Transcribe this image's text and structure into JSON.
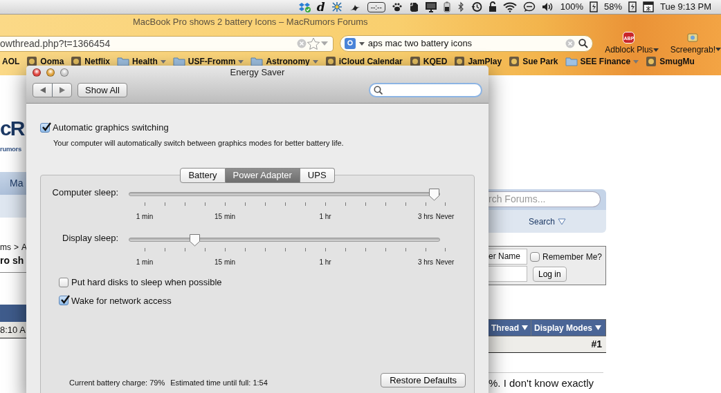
{
  "menu_bar": {
    "letter_icon": "d",
    "timer_display": "--:--",
    "battery_readings": [
      "100%",
      "58%"
    ],
    "clock": "Tue 9:13 PM"
  },
  "browser": {
    "title": "MacBook Pro shows 2 battery Icons – MacRumors Forums",
    "url": "owthread.php?t=1366454",
    "search_query": "aps mac two battery icons",
    "extensions": [
      {
        "label": "Adblock Plus",
        "kind": "abp",
        "badge": "ABP"
      },
      {
        "label": "Screengrab!",
        "kind": "screengrab"
      }
    ],
    "bookmarks": [
      {
        "label": "AOL",
        "kind": "plain"
      },
      {
        "label": "Ooma",
        "kind": "site"
      },
      {
        "label": "Netflix",
        "kind": "site"
      },
      {
        "label": "Health",
        "kind": "folder"
      },
      {
        "label": "USF-Fromm",
        "kind": "folder"
      },
      {
        "label": "Astronomy",
        "kind": "folder"
      },
      {
        "label": "iCloud Calendar",
        "kind": "site"
      },
      {
        "label": "KQED",
        "kind": "site"
      },
      {
        "label": "JamPlay",
        "kind": "site"
      },
      {
        "label": "Sue Park",
        "kind": "site"
      },
      {
        "label": "SEE Finance",
        "kind": "folder"
      },
      {
        "label": "SmugMu",
        "kind": "site"
      }
    ]
  },
  "web_page": {
    "logo": "cR",
    "logo_tagline": "rumors",
    "nav_tab": "Ma",
    "breadcrumb": {
      "links": [
        "ms",
        "A"
      ],
      "separator": ">"
    },
    "thread_title": "ro sh",
    "post_date": "8:10 A",
    "search_placeholder": "rch Forums...",
    "search_link": "Search",
    "username_value": "er Name",
    "remember_me": {
      "label": "Remember Me?",
      "checked": false
    },
    "login_button": "Log in",
    "toolbar": [
      "Thread",
      "Display Modes"
    ],
    "post_number": "#1",
    "post_text": "%. I don't know exactly"
  },
  "dialog": {
    "title": "Energy Saver",
    "show_all": "Show All",
    "graphics_switching": {
      "label": "Automatic graphics switching",
      "checked": true,
      "description": "Your computer will automatically switch between graphics modes for better battery life."
    },
    "tabs": [
      {
        "label": "Battery",
        "selected": false
      },
      {
        "label": "Power Adapter",
        "selected": true
      },
      {
        "label": "UPS",
        "selected": false
      }
    ],
    "sliders": [
      {
        "label": "Computer sleep:",
        "level": 1.0,
        "tick_labels": [
          "1 min",
          "15 min",
          "1 hr",
          "3 hrs",
          "Never"
        ]
      },
      {
        "label": "Display sleep:",
        "level": 0.2,
        "tick_labels": [
          "1 min",
          "15 min",
          "1 hr",
          "3 hrs",
          "Never"
        ]
      }
    ],
    "options": [
      {
        "label": "Put hard disks to sleep when possible",
        "checked": false
      },
      {
        "label": "Wake for network access",
        "checked": true
      }
    ],
    "battery_charge": "Current battery charge: 79%",
    "time_until_full": "Estimated time until full: 1:54",
    "restore_button": "Restore Defaults"
  }
}
